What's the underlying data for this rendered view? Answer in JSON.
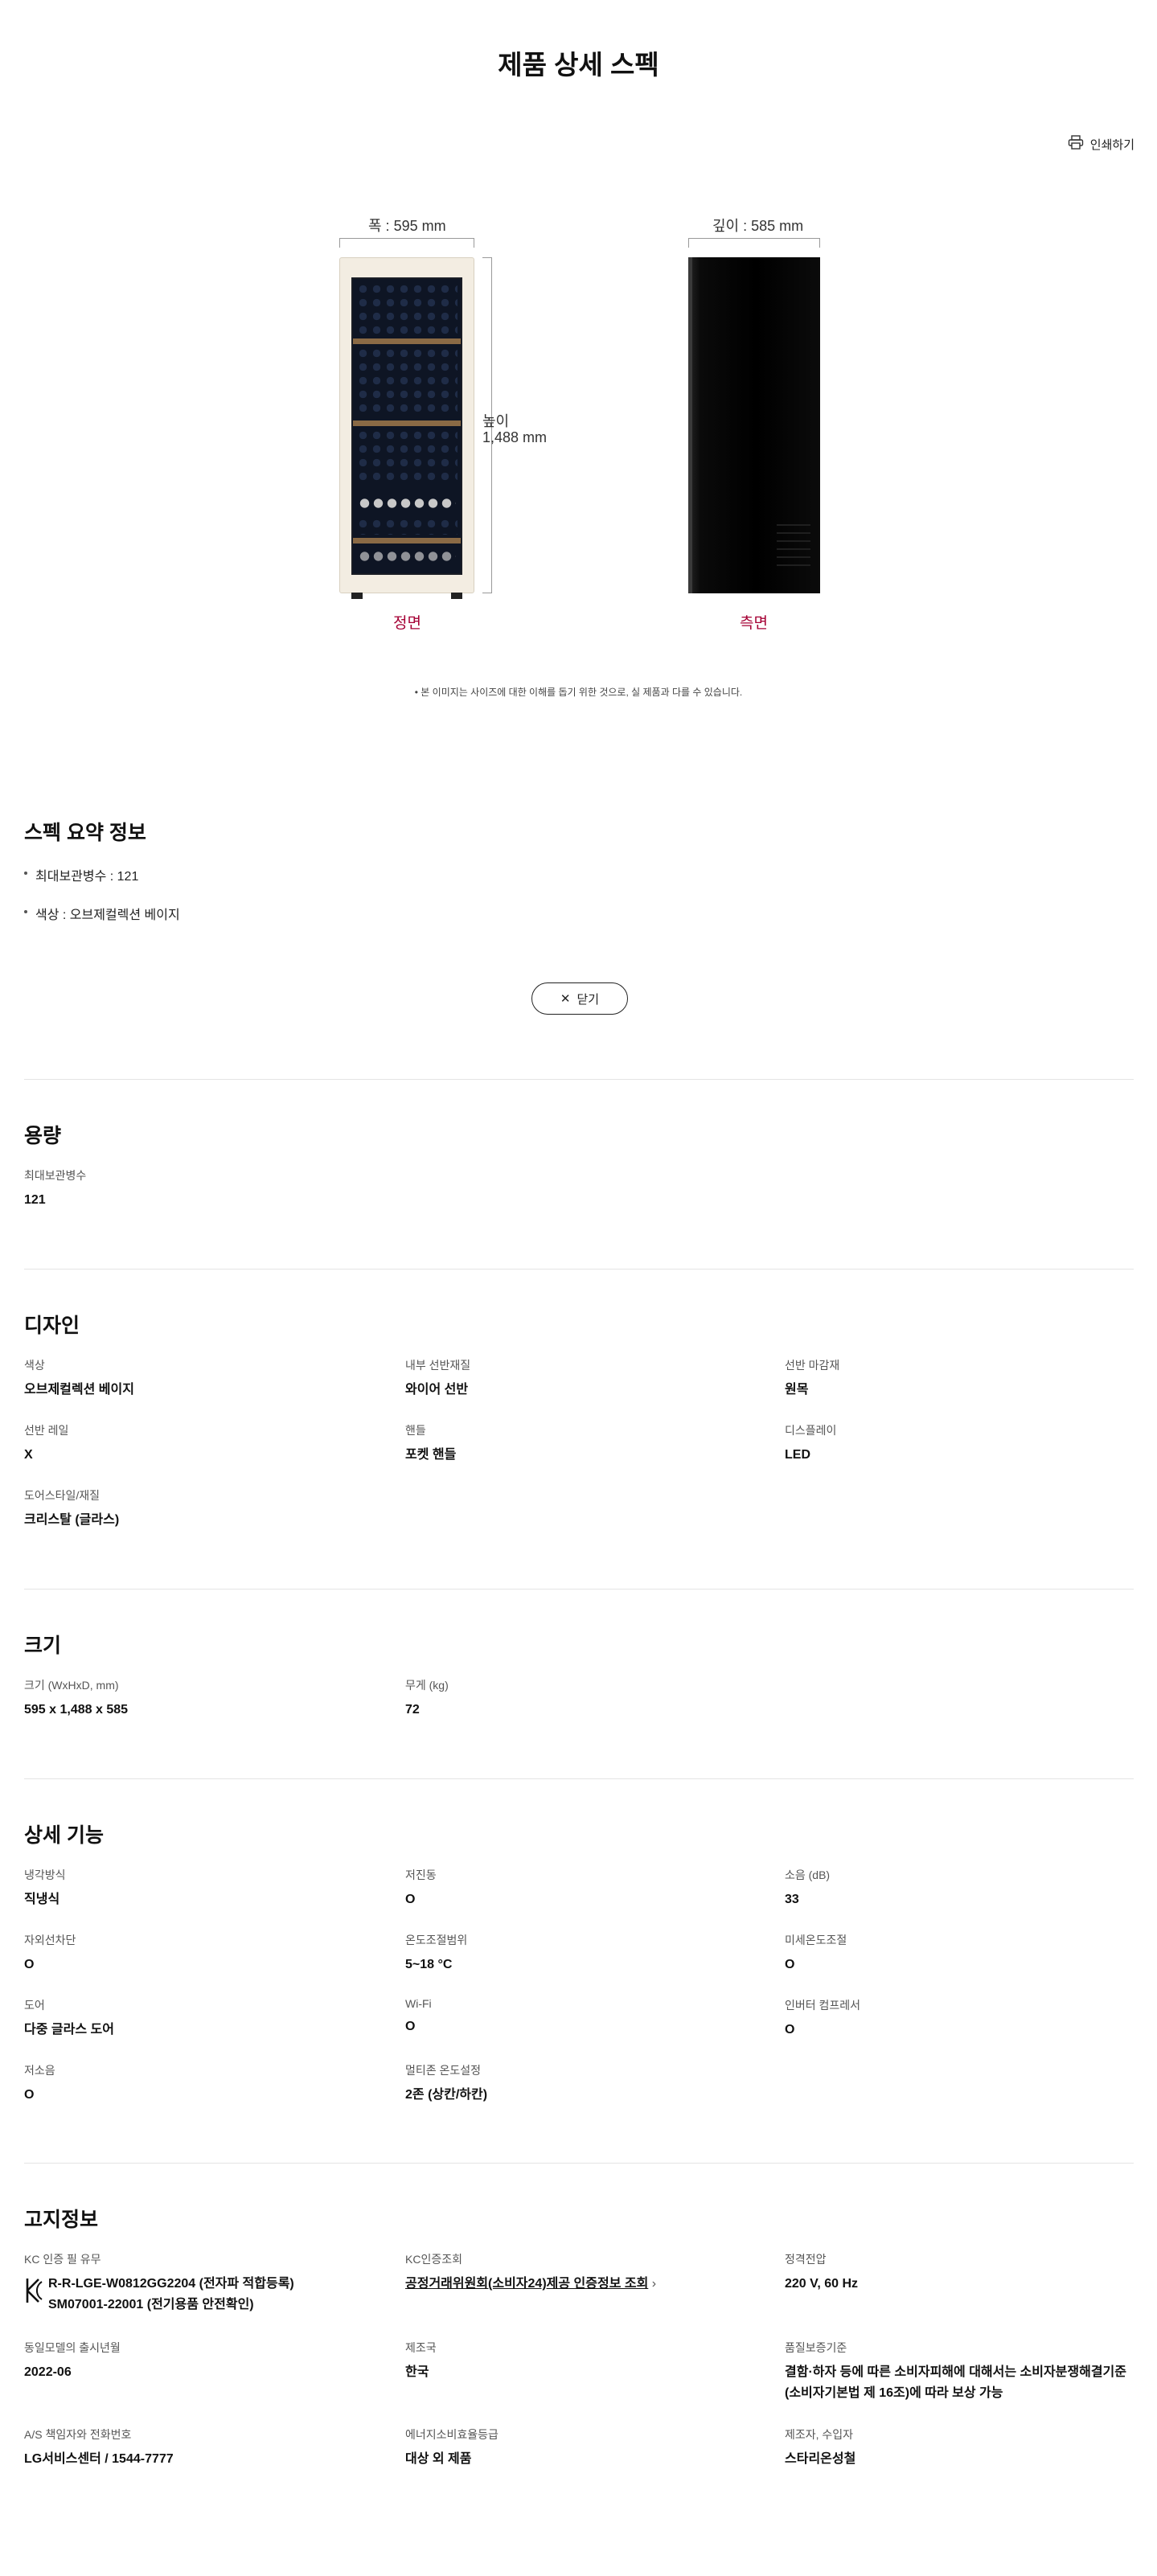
{
  "page": {
    "title": "제품 상세 스펙",
    "print_label": "인쇄하기"
  },
  "figure": {
    "width_label": "폭 : 595 mm",
    "depth_label": "깊이 : 585 mm",
    "height_label_1": "높이",
    "height_label_2": "1,488 mm",
    "front_label": "정면",
    "side_label": "측면",
    "note": "• 본 이미지는 사이즈에 대한 이해를 돕기 위한 것으로, 실 제품과 다를 수 있습니다."
  },
  "summary": {
    "title": "스펙 요약 정보",
    "items": [
      "최대보관병수 : 121",
      "색상 : 오브제컬렉션 베이지"
    ],
    "close_label": "닫기"
  },
  "sections": {
    "capacity": {
      "title": "용량",
      "specs": [
        {
          "label": "최대보관병수",
          "value": "121"
        }
      ]
    },
    "design": {
      "title": "디자인",
      "specs": [
        {
          "label": "색상",
          "value": "오브제컬렉션 베이지"
        },
        {
          "label": "내부 선반재질",
          "value": "와이어 선반"
        },
        {
          "label": "선반 마감재",
          "value": "원목"
        },
        {
          "label": "선반 레일",
          "value": "X"
        },
        {
          "label": "핸들",
          "value": "포켓 핸들"
        },
        {
          "label": "디스플레이",
          "value": "LED"
        },
        {
          "label": "도어스타일/재질",
          "value": "크리스탈 (글라스)"
        }
      ]
    },
    "size": {
      "title": "크기",
      "specs": [
        {
          "label": "크기 (WxHxD, mm)",
          "value": "595 x 1,488 x 585"
        },
        {
          "label": "무게 (kg)",
          "value": "72"
        }
      ]
    },
    "features": {
      "title": "상세 기능",
      "specs": [
        {
          "label": "냉각방식",
          "value": "직냉식"
        },
        {
          "label": "저진동",
          "value": "O"
        },
        {
          "label": "소음 (dB)",
          "value": "33"
        },
        {
          "label": "자외선차단",
          "value": "O"
        },
        {
          "label": "온도조절범위",
          "value": "5~18 °C"
        },
        {
          "label": "미세온도조절",
          "value": "O"
        },
        {
          "label": "도어",
          "value": "다중 글라스 도어"
        },
        {
          "label": "Wi-Fi",
          "value": "O"
        },
        {
          "label": "인버터 컴프레서",
          "value": "O"
        },
        {
          "label": "저소음",
          "value": "O"
        },
        {
          "label": "멀티존 온도설정",
          "value": "2존 (상칸/하칸)"
        }
      ]
    },
    "notice": {
      "title": "고지정보",
      "specs": [
        {
          "label": "KC 인증 필 유무",
          "value_line1": "R-R-LGE-W0812GG2204 (전자파 적합등록)",
          "value_line2": "SM07001-22001 (전기용품 안전확인)"
        },
        {
          "label": "KC인증조회",
          "value": "공정거래위원회(소비자24)제공 인증정보 조회",
          "arrow": "›"
        },
        {
          "label": "정격전압",
          "value": "220 V, 60 Hz"
        },
        {
          "label": "동일모델의 출시년월",
          "value": "2022-06"
        },
        {
          "label": "제조국",
          "value": "한국"
        },
        {
          "label": "품질보증기준",
          "value_line1": "결함·하자 등에 따른 소비자피해에 대해서는 소비자분쟁해결기준",
          "value_line2": "(소비자기본법 제 16조)에 따라 보상 가능"
        },
        {
          "label": "A/S 책임자와 전화번호",
          "value": "LG서비스센터 / 1544-7777"
        },
        {
          "label": "에너지소비효율등급",
          "value": "대상 외 제품"
        },
        {
          "label": "제조자, 수입자",
          "value": "스타리온성철"
        }
      ]
    }
  }
}
